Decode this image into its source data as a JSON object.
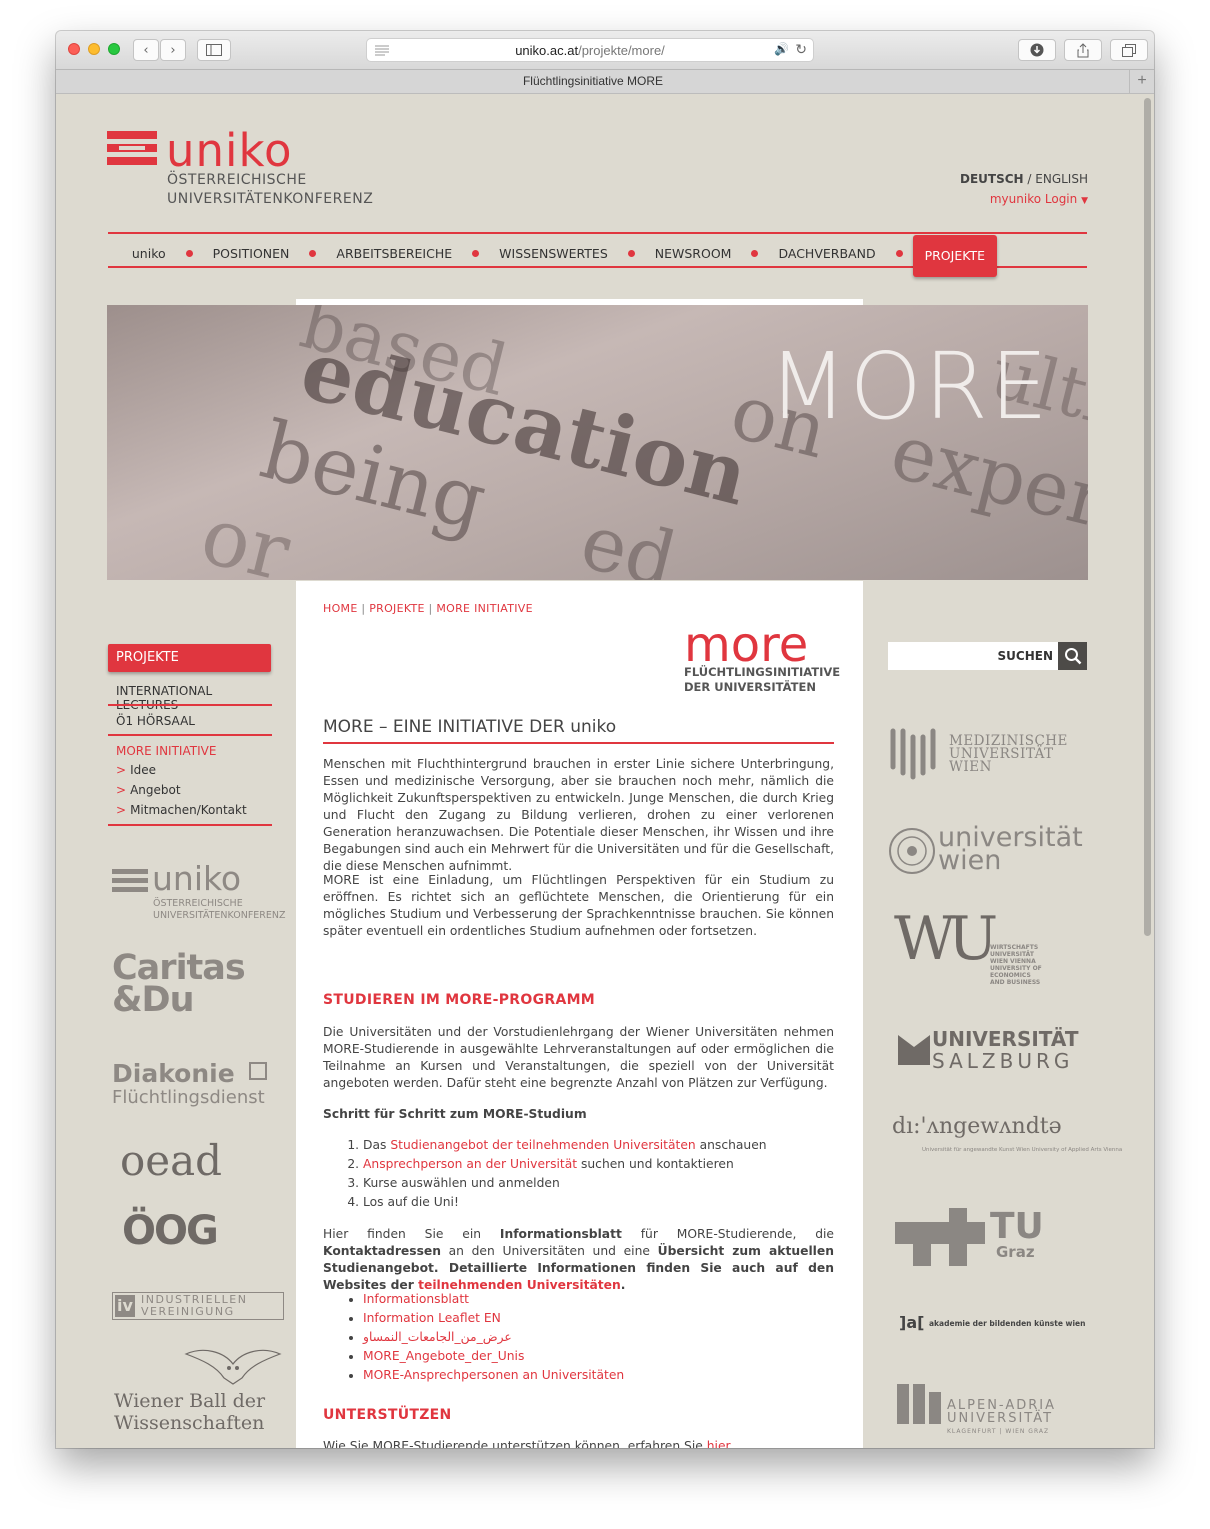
{
  "browser": {
    "url_domain": "uniko.ac.at",
    "url_path": "/projekte/more/",
    "tab_title": "Flüchtlingsinitiative MORE"
  },
  "header": {
    "logo_word": "uniko",
    "logo_sub1": "ÖSTERREICHISCHE",
    "logo_sub2": "UNIVERSITÄTENKONFERENZ",
    "lang_de": "DEUTSCH",
    "lang_sep": " / ",
    "lang_en": "ENGLISH",
    "login": "myuniko Login"
  },
  "nav": {
    "items": [
      "uniko",
      "POSITIONEN",
      "ARBEITSBEREICHE",
      "WISSENSWERTES",
      "NEWSROOM",
      "DACHVERBAND"
    ],
    "active": "PROJEKTE"
  },
  "hero": {
    "title": "MORE"
  },
  "breadcrumb": [
    "HOME",
    "PROJEKTE",
    "MORE INITIATIVE"
  ],
  "more_logo": {
    "word": "more",
    "sub1": "FLÜCHTLINGSINITIATIVE",
    "sub2": "DER UNIVERSITÄTEN"
  },
  "article": {
    "title": "MORE – EINE INITIATIVE DER uniko",
    "p1": "Menschen mit Fluchthintergrund brauchen in erster Linie sichere Unterbringung, Essen und medizinische Versorgung, aber sie brauchen noch mehr, nämlich die Möglichkeit Zukunftsperspektiven zu entwickeln. Junge Menschen, die durch Krieg und Flucht den Zugang zu Bildung verlieren, drohen zu einer verlorenen Generation heranzuwachsen. Die Potentiale dieser Menschen, ihr Wissen und ihre Begabungen sind auch ein Mehrwert für die Universitäten und für die Gesellschaft, die diese Menschen aufnimmt.",
    "p2": "MORE ist eine Einladung, um Flüchtlingen Perspektiven für ein Studium zu eröffnen. Es richtet sich an geflüchtete Menschen, die Orientierung für ein mögliches Studium und Verbesserung der Sprachkenntnisse brauchen. Sie können später eventuell ein ordentliches Studium aufnehmen oder fortsetzen.",
    "h2_studieren": "STUDIEREN IM MORE-PROGRAMM",
    "p3": "Die Universitäten und der Vorstudienlehrgang der Wiener Universitäten nehmen MORE-Studierende in ausgewählte Lehrveranstaltungen auf oder ermöglichen die Teilnahme an Kursen und Veranstaltungen, die speziell von der Universität angeboten werden. Dafür steht eine begrenzte Anzahl von Plätzen zur Verfügung.",
    "steps_title": "Schritt für Schritt zum MORE-Studium",
    "step1_pre": "Das ",
    "step1_link": "Studienangebot der teilnehmenden Universitäten",
    "step1_post": " anschauen",
    "step2_link": "Ansprechperson an der Universität",
    "step2_post": " suchen und kontaktieren",
    "step3": "Kurse auswählen und anmelden",
    "step4": "Los auf die Uni!",
    "p4_a": "Hier finden Sie ein ",
    "p4_b": "Informationsblatt",
    "p4_c": " für MORE-Studierende, die ",
    "p4_d": "Kontaktadressen",
    "p4_e": " an den Universitäten und eine ",
    "p4_f": "Übersicht zum aktuellen Studienangebot. Detaillierte Informationen finden Sie auch  auf den Websites der ",
    "p4_link": "teilnehmenden Universitäten",
    "p4_g": ".",
    "links": [
      "Informationsblatt",
      "Information Leaflet EN",
      "عرض_من_الجامعات_النمساو",
      "MORE_Angebote_der_Unis",
      "MORE-Ansprechpersonen an Universitäten"
    ],
    "h2_unterstuetzen": "UNTERSTÜTZEN",
    "p5": "Wie Sie MORE-Studierende unterstützen können, erfahren Sie ",
    "p5_link": "hier"
  },
  "sidebar": {
    "active": "PROJEKTE",
    "items": [
      "INTERNATIONAL LECTURES",
      "Ö1 HÖRSAAL",
      "MORE INITIATIVE"
    ],
    "sub_items": [
      "Idee",
      "Angebot",
      "Mitmachen/Kontakt"
    ]
  },
  "partners_left": {
    "uniko": "uniko",
    "uniko_sub1": "ÖSTERREICHISCHE",
    "uniko_sub2": "UNIVERSITÄTENKONFERENZ",
    "caritas1": "Caritas",
    "caritas2": "&Du",
    "diakonie1": "Diakonie",
    "diakonie2": "Flüchtlingsdienst",
    "oead": "oead",
    "oeog": "ÖOG",
    "iv1": "INDUSTRIELLEN",
    "iv2": "VEREINIGUNG",
    "ball1": "Wiener Ball der",
    "ball2": "Wissenschaften"
  },
  "search": {
    "label": "SUCHEN"
  },
  "universities": {
    "meduni1": "MEDIZINISCHE",
    "meduni2": "UNIVERSITÄT",
    "meduni3": "WIEN",
    "uniwien1": "universität",
    "uniwien2": "wien",
    "wu": "WU",
    "wu_sub": "WIRTSCHAFTS UNIVERSITÄT WIEN VIENNA UNIVERSITY OF ECONOMICS AND BUSINESS",
    "salzburg1": "UNIVERSITÄT",
    "salzburg2": "SALZBURG",
    "angewandte": "dı:'ʌngewʌndtə",
    "angewandte_sub": "Universität für angewandte Kunst Wien  University of Applied Arts Vienna",
    "tugraz1": "TU",
    "tugraz2": "Graz",
    "akbild_mark": "]a[",
    "akbild": "akademie der bildenden künste wien",
    "aau1": "ALPEN-ADRIA",
    "aau2": "UNIVERSITÄT",
    "aau3": "KLAGENFURT | WIEN GRAZ"
  },
  "colors": {
    "accent": "#e0363f",
    "page_bg": "#dddad0",
    "content_bg": "#ffffff"
  }
}
